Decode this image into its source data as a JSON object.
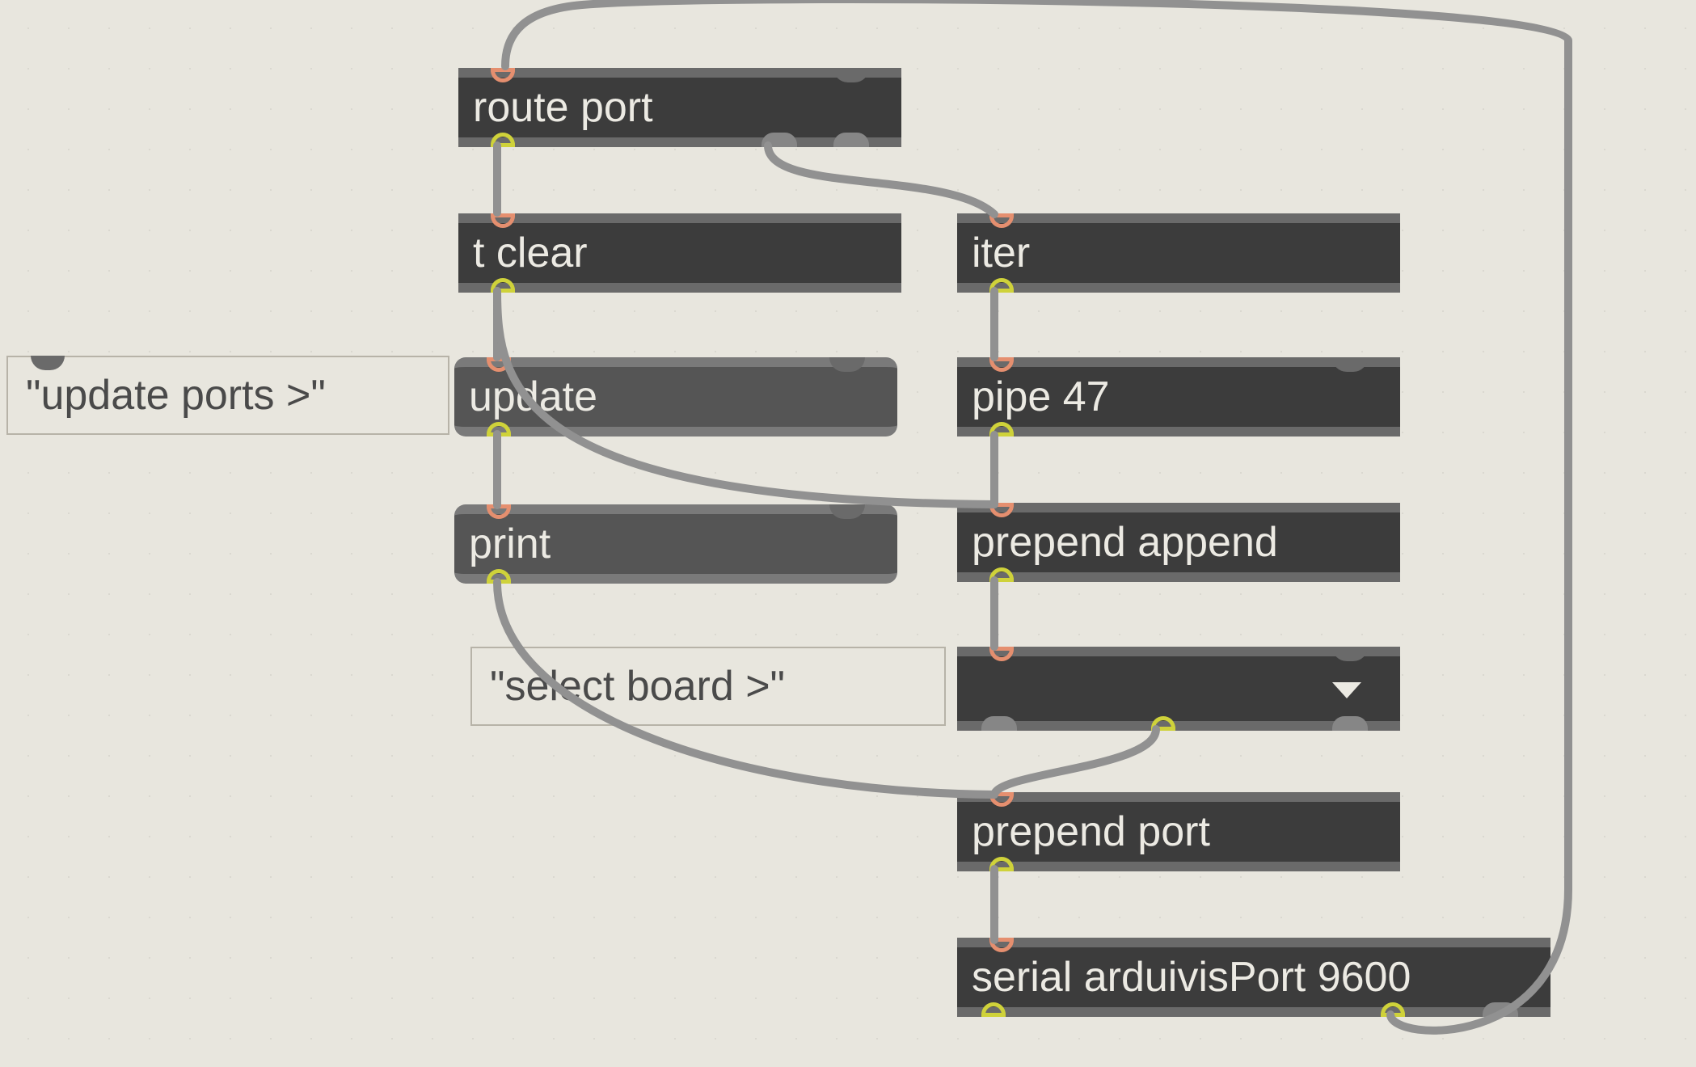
{
  "nodes": {
    "route": {
      "label": "route port"
    },
    "tclear": {
      "label": "t clear"
    },
    "update": {
      "label": "update"
    },
    "print": {
      "label": "print"
    },
    "iter": {
      "label": "iter"
    },
    "pipe": {
      "label": "pipe 47"
    },
    "prependAppend": {
      "label": "prepend append"
    },
    "prependPort": {
      "label": "prepend port"
    },
    "serial": {
      "label": "serial arduivisPort 9600"
    }
  },
  "comments": {
    "updatePorts": {
      "text": "\"update ports >\""
    },
    "selectBoard": {
      "text": "\"select board >\""
    }
  }
}
